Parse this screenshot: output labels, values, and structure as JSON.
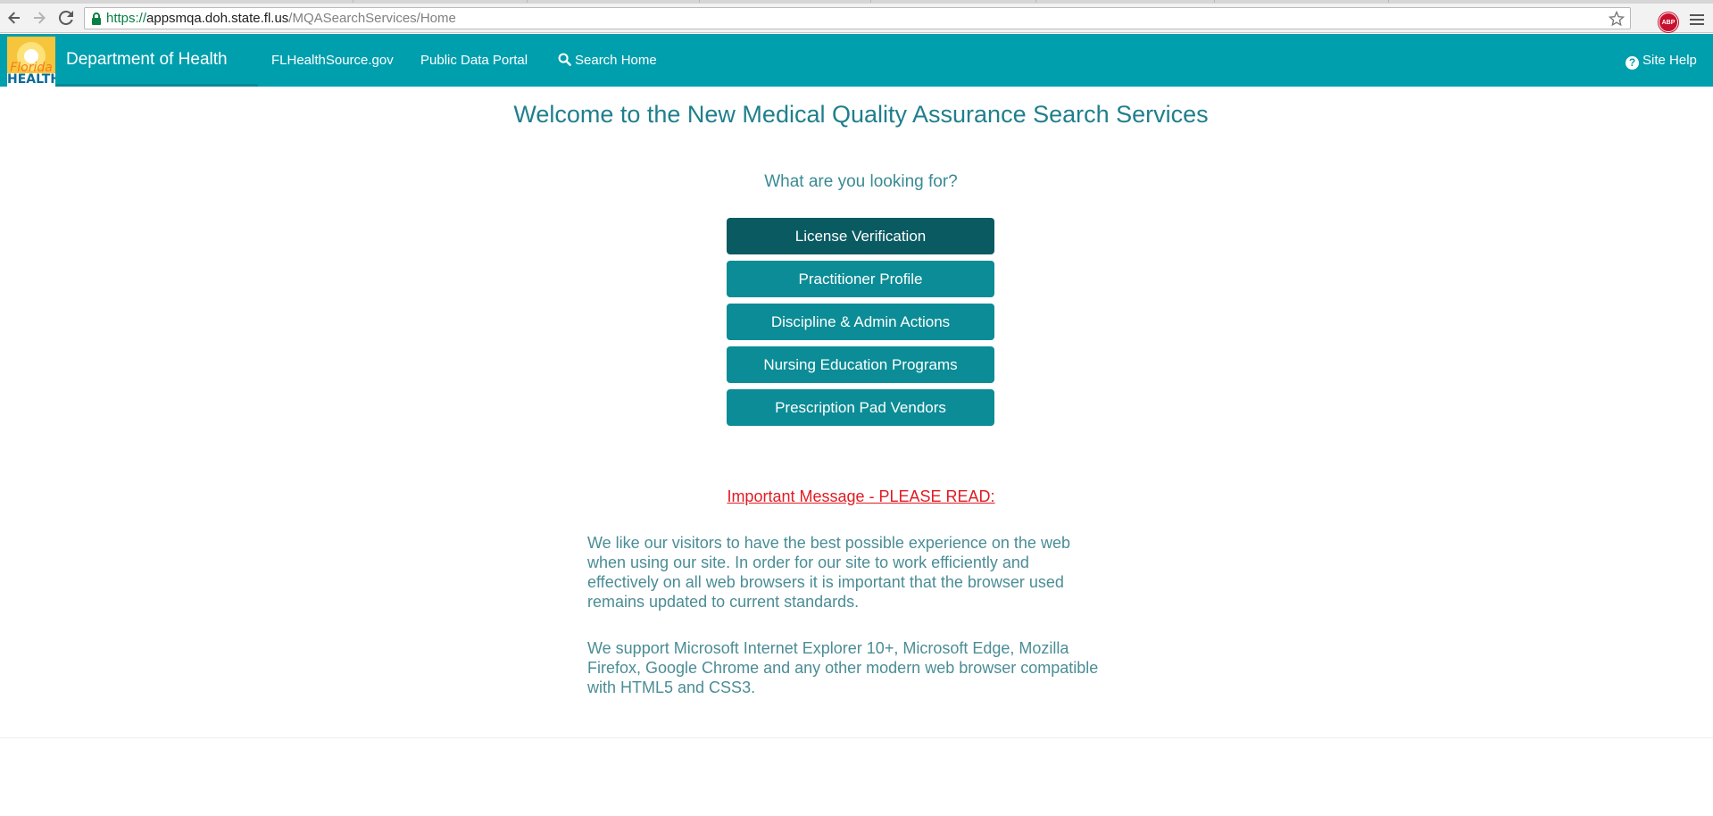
{
  "browser": {
    "url_protocol": "https://",
    "url_host": "appsmqa.doh.state.fl.us",
    "url_path": "/MQASearchServices/Home",
    "extension_badge": "ABP"
  },
  "navbar": {
    "logo_line1": "Florida",
    "logo_line2": "HEALTH",
    "brand": "Department of Health",
    "links": [
      {
        "label": "FLHealthSource.gov"
      },
      {
        "label": "Public Data Portal"
      },
      {
        "label": "Search Home",
        "icon": "search-icon"
      }
    ],
    "help_label": "Site Help",
    "help_icon": "?"
  },
  "main": {
    "title": "Welcome to the New Medical Quality Assurance Search Services",
    "subtitle": "What are you looking for?",
    "buttons": [
      {
        "label": "License Verification",
        "active": true
      },
      {
        "label": "Practitioner Profile"
      },
      {
        "label": "Discipline & Admin Actions"
      },
      {
        "label": "Nursing Education Programs"
      },
      {
        "label": "Prescription Pad Vendors"
      }
    ],
    "important_link": "Important Message - PLEASE READ:",
    "paragraph1": "We like our visitors to have the best possible experience on the web when using our site. In order for our site to work efficiently and effectively on all web browsers it is important that the browser used remains updated to current standards.",
    "paragraph2": "We support Microsoft Internet Explorer 10+, Microsoft Edge, Mozilla Firefox, Google Chrome and any other modern web browser compatible with HTML5 and CSS3."
  },
  "colors": {
    "navbar": "#009fae",
    "button": "#0b8c96",
    "button_active": "#0a5a62",
    "title_text": "#1f7f8c",
    "important": "#e11b23"
  }
}
